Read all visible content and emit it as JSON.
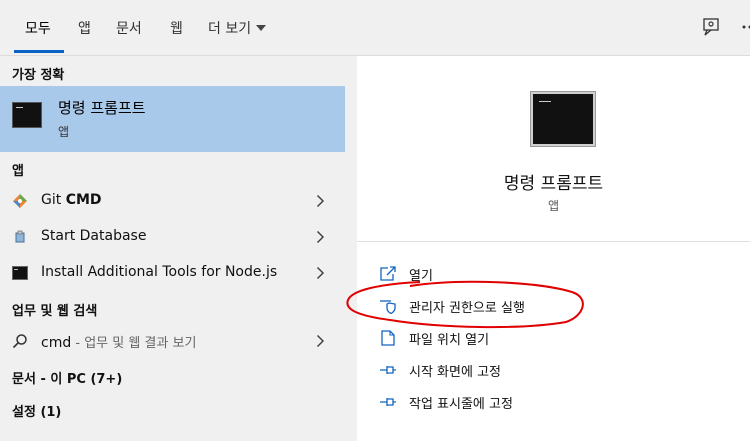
{
  "tabs": [
    {
      "label": "모두"
    },
    {
      "label": "앱"
    },
    {
      "label": "문서"
    },
    {
      "label": "웹"
    },
    {
      "label": "더 보기"
    }
  ],
  "left": {
    "best_match_header": "가장 정확",
    "best_match": {
      "title": "명령 프롬프트",
      "subtitle": "앱",
      "icon": "command-prompt-icon"
    },
    "apps_header": "앱",
    "apps": [
      {
        "prefix": "Git ",
        "bold": "CMD",
        "icon": "git-icon"
      },
      {
        "prefix": "Start Database",
        "bold": "",
        "icon": "database-icon"
      },
      {
        "prefix": "Install Additional Tools for Node.js",
        "bold": "",
        "icon": "terminal-icon"
      }
    ],
    "web_header": "업무 및 웹 검색",
    "web_item": {
      "query": "cmd",
      "hint": " - 업무 및 웹 결과 보기",
      "icon": "search-icon"
    },
    "documents_header": "문서 - 이 PC (7+)",
    "settings_header": "설정 (1)"
  },
  "right": {
    "title": "명령 프롬프트",
    "subtitle": "앱",
    "actions": [
      {
        "label": "열기",
        "icon": "open-icon"
      },
      {
        "label": "관리자 권한으로 실행",
        "icon": "admin-shield-icon"
      },
      {
        "label": "파일 위치 열기",
        "icon": "file-location-icon"
      },
      {
        "label": "시작 화면에 고정",
        "icon": "pin-icon"
      },
      {
        "label": "작업 표시줄에 고정",
        "icon": "pin-icon"
      }
    ]
  },
  "colors": {
    "accent": "#0a64c8",
    "selected": "#a9c9ea",
    "annotation": "#e00000"
  }
}
